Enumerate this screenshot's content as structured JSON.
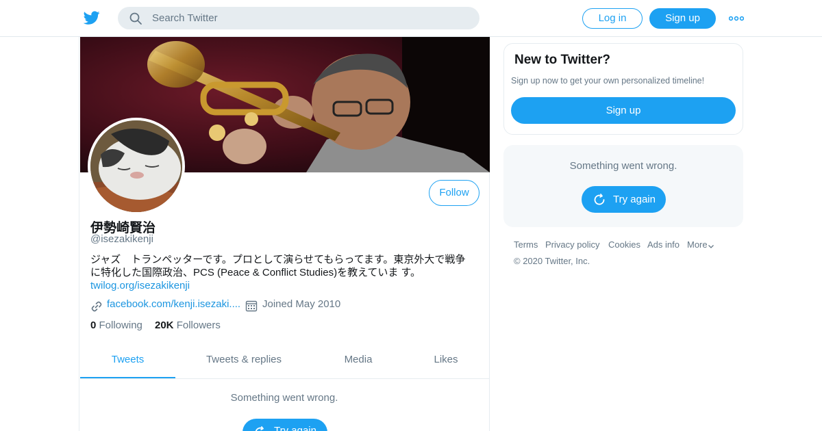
{
  "header": {
    "search_placeholder": "Search Twitter",
    "login_label": "Log in",
    "signup_label": "Sign up",
    "brand_color": "#1da1f2"
  },
  "profile": {
    "follow_label": "Follow",
    "name": "伊勢崎賢治",
    "handle": "@isezakikenji",
    "bio_text": "ジャズ　トランペッターです。プロとして演らせてもらってます。東京外大で戦争に特化した国際政治、PCS (Peace & Conflict Studies)を教えていま す。",
    "bio_link": "twilog.org/isezakikenji",
    "url": "facebook.com/kenji.isezaki....",
    "joined": "Joined May 2010",
    "following_count": "0",
    "following_label": "Following",
    "followers_count": "20K",
    "followers_label": "Followers"
  },
  "tabs": [
    {
      "label": "Tweets",
      "active": true
    },
    {
      "label": "Tweets & replies",
      "active": false
    },
    {
      "label": "Media",
      "active": false
    },
    {
      "label": "Likes",
      "active": false
    }
  ],
  "timeline": {
    "error_text": "Something went wrong.",
    "retry_label": "Try again"
  },
  "sidebar": {
    "signup_card": {
      "title": "New to Twitter?",
      "subtitle": "Sign up now to get your own personalized timeline!",
      "button_label": "Sign up"
    },
    "error_card": {
      "message": "Something went wrong.",
      "retry_label": "Try again"
    },
    "footer": {
      "links": [
        "Terms",
        "Privacy policy",
        "Cookies",
        "Ads info",
        "More"
      ],
      "copyright": "© 2020 Twitter, Inc."
    }
  },
  "icons": [
    "twitter-bird-icon",
    "search-icon",
    "more-dots-icon",
    "link-icon",
    "calendar-icon",
    "refresh-icon",
    "chevron-down-icon"
  ]
}
